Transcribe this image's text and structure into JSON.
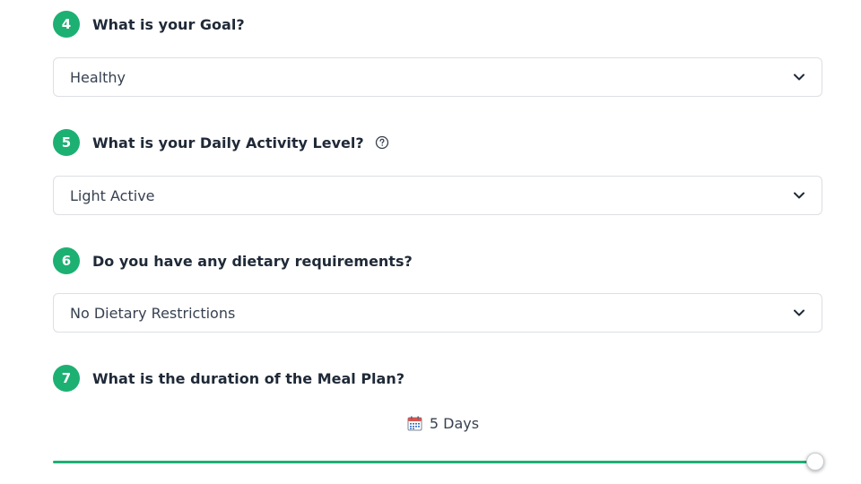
{
  "questions": [
    {
      "number": "4",
      "text": "What is your Goal?",
      "value": "Healthy"
    },
    {
      "number": "5",
      "text": "What is your Daily Activity Level?",
      "value": "Light Active",
      "help_icon": "question-circle-icon"
    },
    {
      "number": "6",
      "text": "Do you have any dietary requirements?",
      "value": "No Dietary Restrictions"
    },
    {
      "number": "7",
      "text": "What is the duration of the Meal Plan?"
    }
  ],
  "duration": {
    "icon": "calendar-icon",
    "label": "5 Days",
    "slider_fraction": 1.0
  },
  "colors": {
    "accent": "#1db073",
    "text": "#1f2937",
    "border": "#dcdfe4"
  }
}
